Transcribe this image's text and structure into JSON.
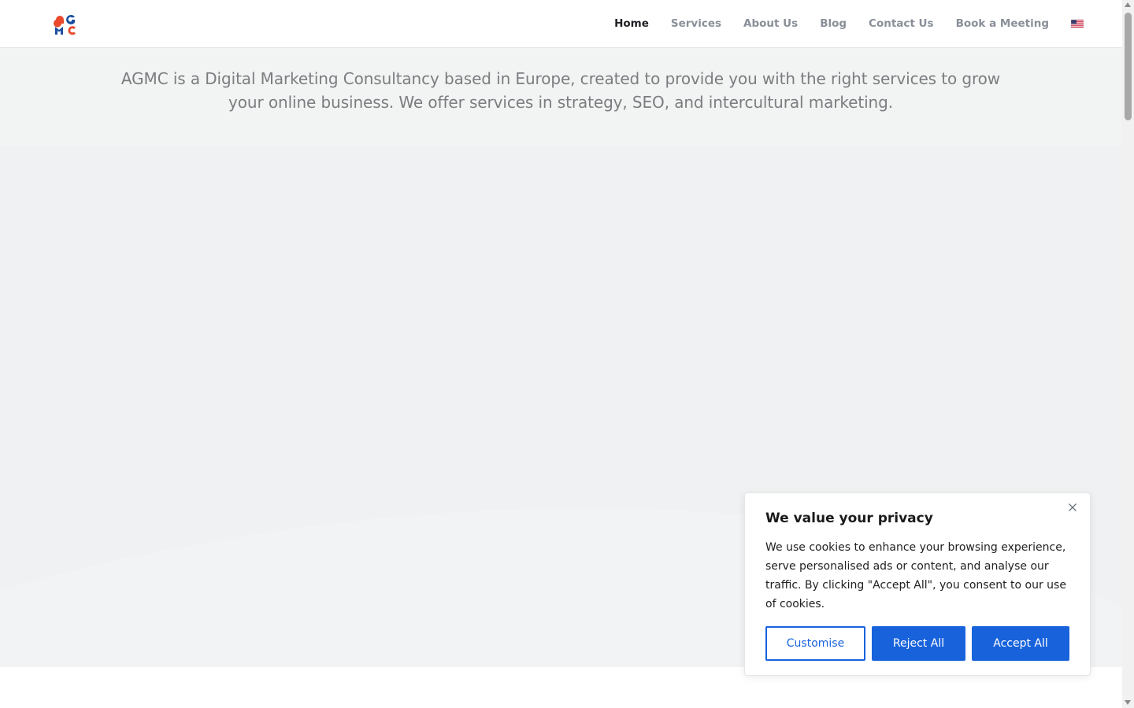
{
  "brand": {
    "logo_icon": "agmc-logo-icon",
    "colors": {
      "blue": "#1b4fa1",
      "red": "#e84a2b",
      "accent": "#1863dc"
    }
  },
  "nav": {
    "items": [
      {
        "label": "Home",
        "active": true
      },
      {
        "label": "Services",
        "active": false
      },
      {
        "label": "About Us",
        "active": false
      },
      {
        "label": "Blog",
        "active": false
      },
      {
        "label": "Contact Us",
        "active": false
      },
      {
        "label": "Book a Meeting",
        "active": false
      }
    ],
    "language_icon": "us-flag-icon"
  },
  "hero": {
    "tagline": "AGMC is a Digital Marketing Consultancy based in Europe, created to provide you with the right services to grow your online business. We offer services in strategy, SEO, and intercultural marketing."
  },
  "cookie_banner": {
    "title": "We value your privacy",
    "text": "We use cookies to enhance your browsing experience, serve personalised ads or content, and analyse our traffic. By clicking \"Accept All\", you consent to our use of cookies.",
    "customise_label": "Customise",
    "reject_label": "Reject All",
    "accept_label": "Accept All",
    "close_icon": "close-icon"
  }
}
